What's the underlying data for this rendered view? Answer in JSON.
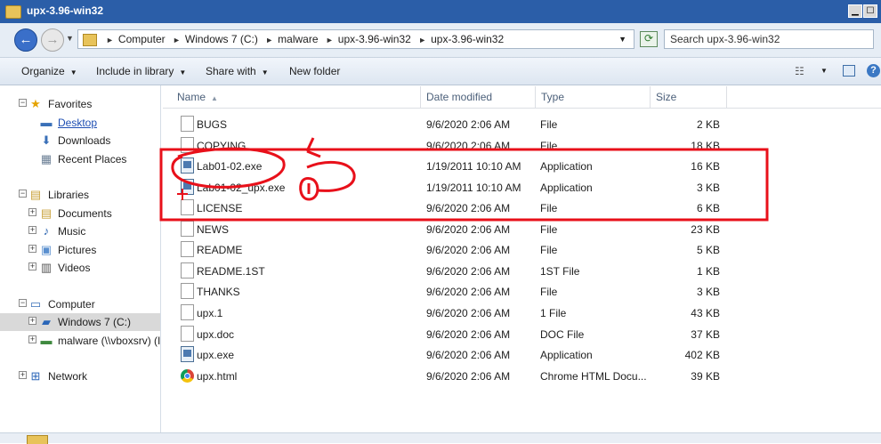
{
  "window": {
    "title": "upx-3.96-win32"
  },
  "address": {
    "crumbs": [
      "Computer",
      "Windows 7 (C:)",
      "malware",
      "upx-3.96-win32",
      "upx-3.96-win32"
    ]
  },
  "search": {
    "placeholder": "Search upx-3.96-win32"
  },
  "toolbar": {
    "organize": "Organize",
    "include_in_library": "Include in library",
    "share_with": "Share with",
    "new_folder": "New folder"
  },
  "nav": {
    "favorites": "Favorites",
    "desktop": "Desktop",
    "downloads": "Downloads",
    "recent_places": "Recent Places",
    "libraries": "Libraries",
    "documents": "Documents",
    "music": "Music",
    "pictures": "Pictures",
    "videos": "Videos",
    "computer": "Computer",
    "windows_c": "Windows 7 (C:)",
    "malware_share": "malware (\\\\vboxsrv) (I",
    "network": "Network"
  },
  "columns": {
    "name": "Name",
    "date": "Date modified",
    "type": "Type",
    "size": "Size"
  },
  "files": [
    {
      "name": "BUGS",
      "date": "9/6/2020 2:06 AM",
      "type": "File",
      "size": "2 KB",
      "icon": "file-icon"
    },
    {
      "name": "COPYING",
      "date": "9/6/2020 2:06 AM",
      "type": "File",
      "size": "18 KB",
      "icon": "file-icon"
    },
    {
      "name": "Lab01-02.exe",
      "date": "1/19/2011 10:10 AM",
      "type": "Application",
      "size": "16 KB",
      "icon": "application-icon"
    },
    {
      "name": "Lab01-02_upx.exe",
      "date": "1/19/2011 10:10 AM",
      "type": "Application",
      "size": "3 KB",
      "icon": "application-icon"
    },
    {
      "name": "LICENSE",
      "date": "9/6/2020 2:06 AM",
      "type": "File",
      "size": "6 KB",
      "icon": "file-icon"
    },
    {
      "name": "NEWS",
      "date": "9/6/2020 2:06 AM",
      "type": "File",
      "size": "23 KB",
      "icon": "file-icon"
    },
    {
      "name": "README",
      "date": "9/6/2020 2:06 AM",
      "type": "File",
      "size": "5 KB",
      "icon": "file-icon"
    },
    {
      "name": "README.1ST",
      "date": "9/6/2020 2:06 AM",
      "type": "1ST File",
      "size": "1 KB",
      "icon": "file-icon"
    },
    {
      "name": "THANKS",
      "date": "9/6/2020 2:06 AM",
      "type": "File",
      "size": "3 KB",
      "icon": "file-icon"
    },
    {
      "name": "upx.1",
      "date": "9/6/2020 2:06 AM",
      "type": "1 File",
      "size": "43 KB",
      "icon": "file-icon"
    },
    {
      "name": "upx.doc",
      "date": "9/6/2020 2:06 AM",
      "type": "DOC File",
      "size": "37 KB",
      "icon": "file-icon"
    },
    {
      "name": "upx.exe",
      "date": "9/6/2020 2:06 AM",
      "type": "Application",
      "size": "402 KB",
      "icon": "application-icon"
    },
    {
      "name": "upx.html",
      "date": "9/6/2020 2:06 AM",
      "type": "Chrome HTML Docu...",
      "size": "39 KB",
      "icon": "chrome-html-icon"
    }
  ],
  "colors": {
    "titlebar": "#2b5ea8",
    "annotation": "#e8101a",
    "selected_nav": "#d9d9d9",
    "link_blue": "#1f4fb3"
  }
}
